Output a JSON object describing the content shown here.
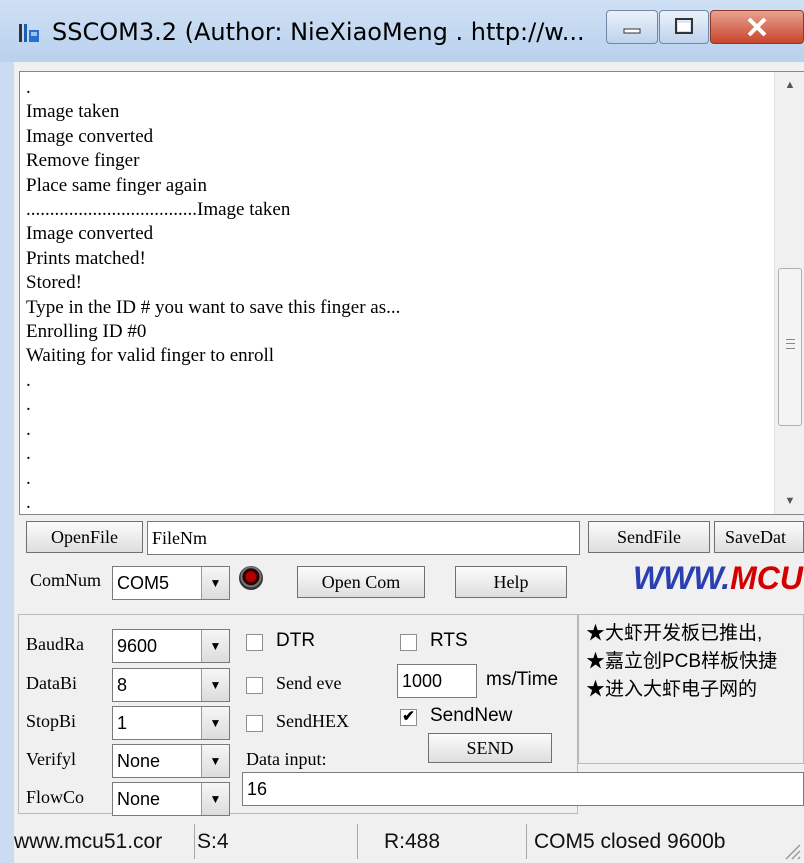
{
  "window": {
    "title": "SSCOM3.2 (Author: NieXiaoMeng . http://w...",
    "icons": {
      "app": "sscom-app-icon",
      "minimize": "minimize-icon",
      "maximize": "maximize-icon",
      "close": "close-icon"
    }
  },
  "terminal": {
    "lines": [
      ".",
      "Image taken",
      "Image converted",
      "Remove finger",
      "Place same finger again",
      "....................................Image taken",
      "Image converted",
      "Prints matched!",
      "Stored!",
      "Type in the ID # you want to save this finger as...",
      "Enrolling ID #0",
      "Waiting for valid finger to enroll",
      ".",
      ".",
      ".",
      ".",
      ".",
      "."
    ]
  },
  "file_row": {
    "open_file_label": "OpenFile",
    "file_name_value": "FileNm",
    "send_file_label": "SendFile",
    "save_data_label": "SaveDat"
  },
  "com_row": {
    "com_num_label": "ComNum",
    "com_port_value": "COM5",
    "open_com_label": "Open Com",
    "help_label": "Help",
    "website_blue": "WWW.",
    "website_red": "MCU"
  },
  "settings": {
    "baud_label": "BaudRa",
    "baud_value": "9600",
    "databits_label": "DataBi",
    "databits_value": "8",
    "stopbits_label": "StopBi",
    "stopbits_value": "1",
    "verify_label": "Verifyl",
    "verify_value": "None",
    "flow_label": "FlowCo",
    "flow_value": "None",
    "dtr_label": "DTR",
    "rts_label": "RTS",
    "send_every_label": "Send eve",
    "interval_value": "1000",
    "interval_unit": "ms/Time",
    "send_hex_label": "SendHEX",
    "send_new_label": "SendNew",
    "send_new_checked": true,
    "data_input_label": "Data input:",
    "send_label": "SEND",
    "input_value": "16"
  },
  "ad_text": "★大虾开发板已推出,\n★嘉立创PCB样板快捷\n★进入大虾电子网的",
  "status_bar": {
    "site": "www.mcu51.cor",
    "sent": "S:4",
    "received": "R:488",
    "port_status": "COM5 closed  9600b"
  }
}
